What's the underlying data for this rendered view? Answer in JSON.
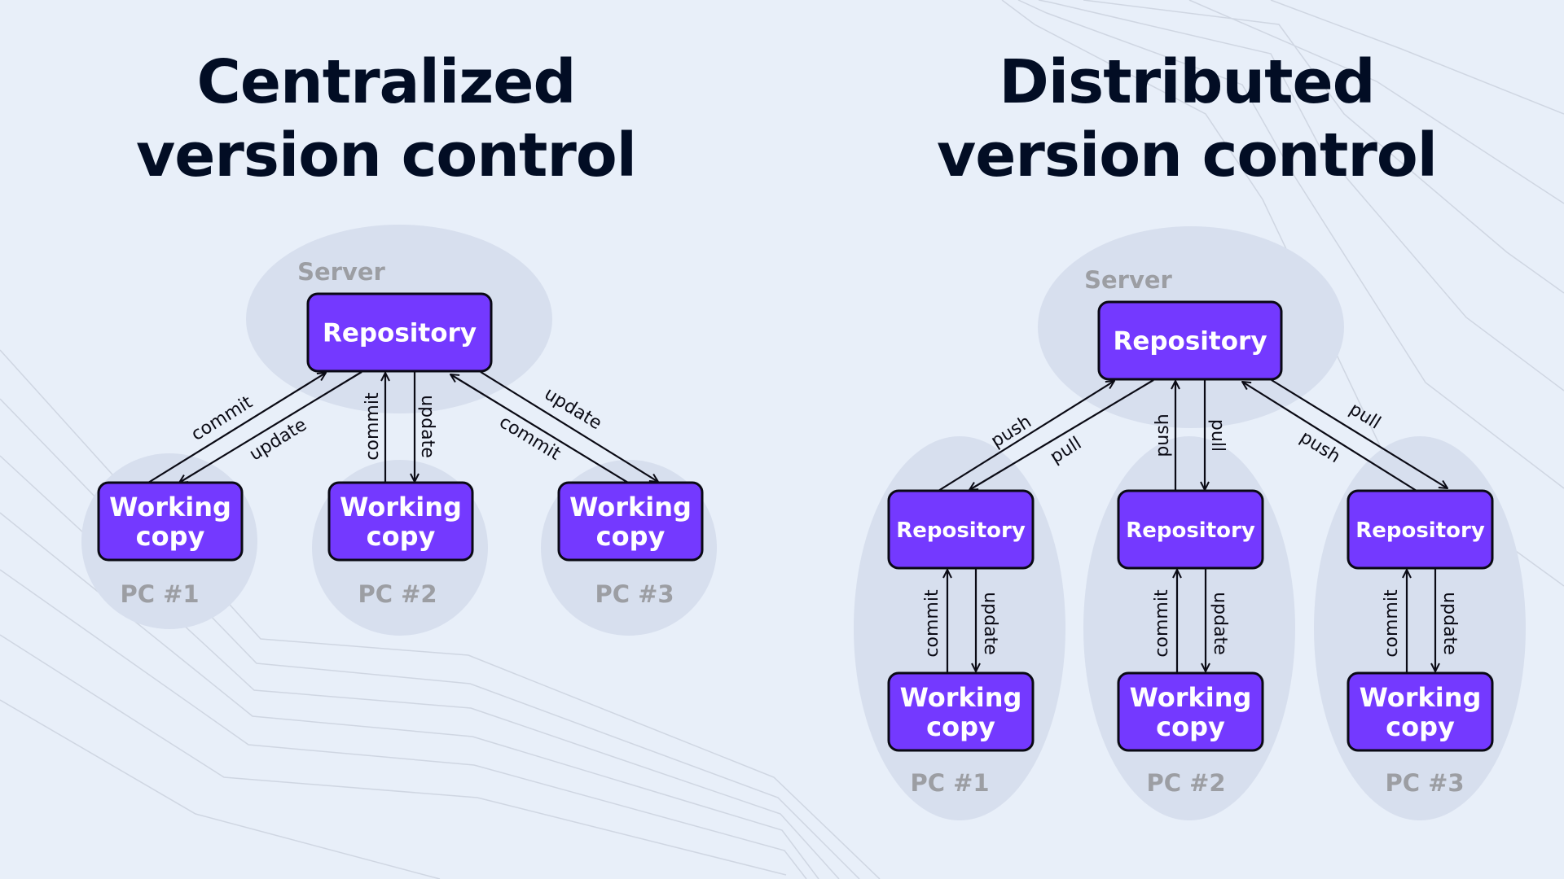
{
  "titles": {
    "left": [
      "Centralized",
      "version control"
    ],
    "right": [
      "Distributed",
      "version control"
    ]
  },
  "centralized": {
    "server_label": "Server",
    "server_box": "Repository",
    "clients": [
      {
        "pc_label": "PC #1",
        "box": [
          "Working",
          "copy"
        ],
        "to_server": "commit",
        "from_server": "update"
      },
      {
        "pc_label": "PC #2",
        "box": [
          "Working",
          "copy"
        ],
        "to_server": "commit",
        "from_server": "update"
      },
      {
        "pc_label": "PC #3",
        "box": [
          "Working",
          "copy"
        ],
        "to_server": "commit",
        "from_server": "update"
      }
    ]
  },
  "distributed": {
    "server_label": "Server",
    "server_box": "Repository",
    "clients": [
      {
        "pc_label": "PC #1",
        "repo_box": "Repository",
        "box": [
          "Working",
          "copy"
        ],
        "to_server": "push",
        "from_server": "pull",
        "local_up": "commit",
        "local_down": "update"
      },
      {
        "pc_label": "PC #2",
        "repo_box": "Repository",
        "box": [
          "Working",
          "copy"
        ],
        "to_server": "push",
        "from_server": "pull",
        "local_up": "commit",
        "local_down": "update"
      },
      {
        "pc_label": "PC #3",
        "repo_box": "Repository",
        "box": [
          "Working",
          "copy"
        ],
        "to_server": "push",
        "from_server": "pull",
        "local_up": "commit",
        "local_down": "update"
      }
    ]
  },
  "colors": {
    "background": "#e8eff9",
    "box_fill": "#7439ff",
    "group_fill": "#d7dfee",
    "title": "#020d24",
    "group_label": "#9c9ea3"
  }
}
